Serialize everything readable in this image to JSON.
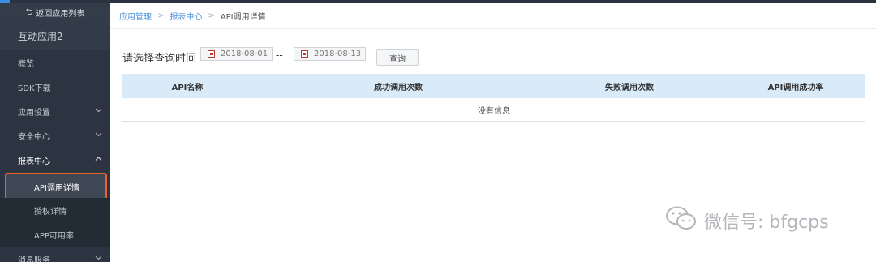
{
  "sidebar": {
    "back_label": "返回应用列表",
    "app_name": "互动应用2",
    "items": [
      {
        "label": "概览"
      },
      {
        "label": "SDK下载"
      },
      {
        "label": "应用设置"
      },
      {
        "label": "安全中心"
      },
      {
        "label": "报表中心"
      },
      {
        "label": "API调用详情"
      },
      {
        "label": "授权详情"
      },
      {
        "label": "APP可用率"
      },
      {
        "label": "消息服务"
      }
    ]
  },
  "breadcrumb": {
    "level1": "应用管理",
    "level2": "报表中心",
    "current": "API调用详情",
    "separator": ">"
  },
  "query": {
    "title": "请选择查询时间",
    "start_date": "2018-08-01",
    "end_date": "2018-08-13",
    "separator": "--",
    "button_label": "查询"
  },
  "table": {
    "columns": [
      "API名称",
      "成功调用次数",
      "失败调用次数",
      "API调用成功率"
    ],
    "empty_text": "没有信息"
  },
  "watermark": {
    "text": "微信号: bfgcps"
  },
  "colors": {
    "sidebar_bg": "#2b3440",
    "highlight_border": "#e8622c",
    "link": "#4a90d9",
    "table_header_bg": "#d9eaf8"
  }
}
